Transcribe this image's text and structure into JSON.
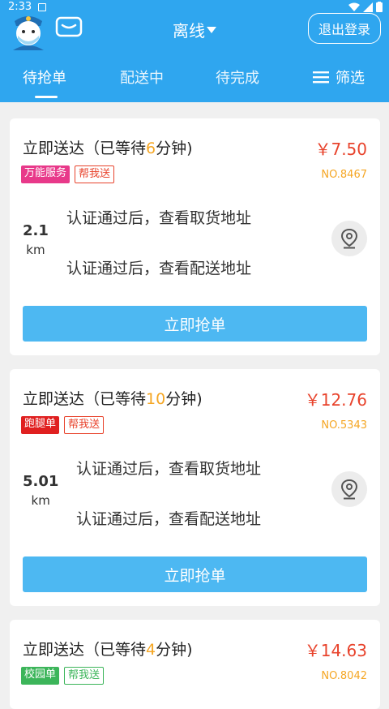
{
  "status_bar": {
    "time": "2:33"
  },
  "header": {
    "status_label": "离线",
    "logout_label": "退出登录"
  },
  "tabs": [
    {
      "label": "待抢单",
      "active": true
    },
    {
      "label": "配送中",
      "active": false
    },
    {
      "label": "待完成",
      "active": false
    }
  ],
  "filter_label": "筛选",
  "orders": [
    {
      "title_prefix": "立即送达（已等待",
      "wait_minutes": "6",
      "title_suffix": "分钟)",
      "price": "￥7.50",
      "order_no": "NO.8467",
      "tag_type": "万能服务",
      "tag_type_color": "#e8398a",
      "tag_help": "帮我送",
      "distance": "2.1",
      "distance_unit": "km",
      "pickup_text": "认证通过后，查看取货地址",
      "delivery_text": "认证通过后，查看配送地址",
      "button_label": "立即抢单"
    },
    {
      "title_prefix": "立即送达（已等待",
      "wait_minutes": "10",
      "title_suffix": "分钟)",
      "price": "￥12.76",
      "order_no": "NO.5343",
      "tag_type": "跑腿单",
      "tag_type_color": "#e02020",
      "tag_help": "帮我送",
      "distance": "5.01",
      "distance_unit": "km",
      "pickup_text": "认证通过后，查看取货地址",
      "delivery_text": "认证通过后，查看配送地址",
      "button_label": "立即抢单"
    },
    {
      "title_prefix": "立即送达（已等待",
      "wait_minutes": "4",
      "title_suffix": "分钟)",
      "price": "￥14.63",
      "order_no": "NO.8042",
      "tag_type": "校园单",
      "tag_type_color": "#3cb55a",
      "tag_help": "帮我送",
      "tag_help_color": "#3cb55a"
    }
  ]
}
